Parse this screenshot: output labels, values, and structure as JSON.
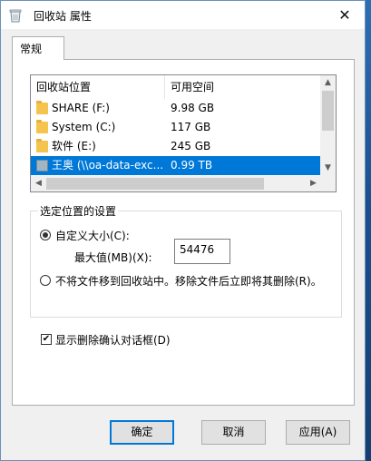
{
  "window": {
    "title": "回收站 属性",
    "close_glyph": "✕"
  },
  "tabs": [
    {
      "label": "常规",
      "active": true
    }
  ],
  "list": {
    "columns": [
      "回收站位置",
      "可用空间"
    ],
    "rows": [
      {
        "location": "SHARE (F:)",
        "free": "9.98 GB",
        "icon": "folder-icon",
        "selected": false
      },
      {
        "location": "System (C:)",
        "free": "117 GB",
        "icon": "folder-icon",
        "selected": false
      },
      {
        "location": "软件 (E:)",
        "free": "245 GB",
        "icon": "folder-icon",
        "selected": false
      },
      {
        "location": "王奥 (\\\\oa-data-exc...",
        "free": "0.99 TB",
        "icon": "network-drive-icon",
        "selected": true
      }
    ]
  },
  "settings": {
    "legend": "选定位置的设置",
    "custom_size_label": "自定义大小(C):",
    "max_label": "最大值(MB)(X):",
    "max_value": "54476",
    "no_move_label": "不将文件移到回收站中。移除文件后立即将其删除(R)。",
    "custom_size_selected": true
  },
  "confirm_dialog": {
    "label": "显示删除确认对话框(D)",
    "checked": true
  },
  "buttons": {
    "ok": "确定",
    "cancel": "取消",
    "apply": "应用(A)"
  },
  "colors": {
    "selection": "#0078d7",
    "desktop": "#1e4e86"
  }
}
